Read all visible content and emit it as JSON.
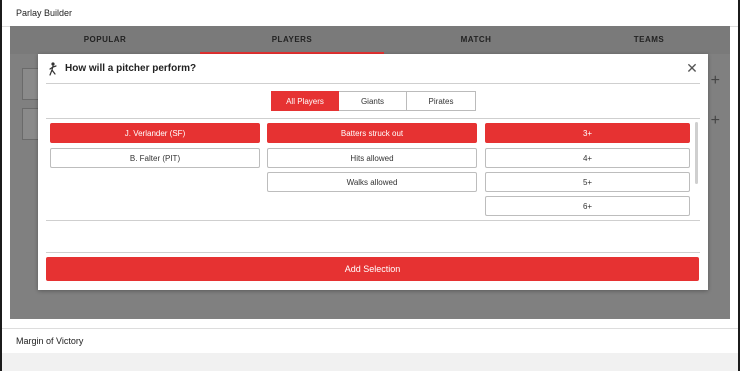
{
  "page": {
    "header_title": "Parlay Builder",
    "margin_row_title": "Margin of Victory"
  },
  "tabs": [
    {
      "label": "POPULAR"
    },
    {
      "label": "PLAYERS",
      "active": true
    },
    {
      "label": "MATCH"
    },
    {
      "label": "TEAMS"
    }
  ],
  "modal": {
    "title": "How will a pitcher perform?",
    "close_icon": "close-icon",
    "title_icon": "pitcher-icon",
    "filters": [
      {
        "label": "All Players",
        "active": true
      },
      {
        "label": "Giants",
        "active": false
      },
      {
        "label": "Pirates",
        "active": false
      }
    ],
    "players": [
      {
        "label": "J. Verlander (SF)",
        "selected": true
      },
      {
        "label": "B. Falter (PIT)",
        "selected": false
      }
    ],
    "stats": [
      {
        "label": "Batters struck out",
        "selected": true
      },
      {
        "label": "Hits allowed",
        "selected": false
      },
      {
        "label": "Walks allowed",
        "selected": false
      }
    ],
    "thresholds": [
      {
        "label": "3+",
        "selected": true
      },
      {
        "label": "4+",
        "selected": false
      },
      {
        "label": "5+",
        "selected": false
      },
      {
        "label": "6+",
        "selected": false
      }
    ],
    "add_button": "Add Selection"
  },
  "colors": {
    "accent": "#e63232",
    "overlay": "#808080"
  }
}
